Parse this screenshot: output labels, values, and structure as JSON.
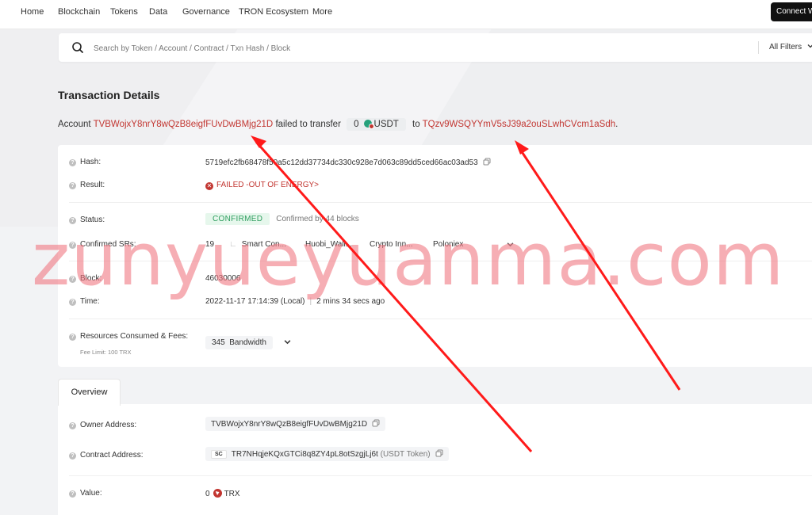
{
  "nav": {
    "items": [
      "Home",
      "Blockchain",
      "Tokens",
      "Data",
      "Governance",
      "TRON Ecosystem",
      "More"
    ],
    "connect_label": "Connect Wallet"
  },
  "search": {
    "placeholder": "Search by Token / Account / Contract / Txn Hash / Block",
    "filters_label": "All Filters"
  },
  "page": {
    "title": "Transaction Details",
    "summary": {
      "prefix": "Account",
      "from_address": "TVBWojxY8nrY8wQzB8eigfFUvDwBMjg21D",
      "middle": "failed to transfer",
      "amount": "0",
      "token": "USDT",
      "to_word": "to",
      "to_address": "TQzv9WSQYYmV5sJ39a2ouSLwhCVcm1aSdh",
      "suffix": "."
    }
  },
  "details": {
    "hash_label": "Hash:",
    "hash_value": "5719efc2fb68478f50a5c12dd37734dc330c928e7d063c89dd5ced66ac03ad53",
    "result_label": "Result:",
    "result_value": "FAILED -OUT OF ENERGY>",
    "status_label": "Status:",
    "status_badge": "CONFIRMED",
    "status_text": "Confirmed by 44 blocks",
    "confirmed_sr_label": "Confirmed SRs:",
    "confirmed_sr_items": [
      "19",
      "Smart Con...",
      "Huobi_Wall...",
      "Crypto Inn...",
      "Poloniex"
    ],
    "block_label": "Block:",
    "block_value": "46030006",
    "time_label": "Time:",
    "time_value": "2022-11-17 17:14:39 (Local)",
    "time_sep": "|",
    "time_ago": "2 mins 34 secs ago",
    "resources_label": "Resources Consumed & Fees:",
    "fee_limit": "Fee Limit: 100 TRX",
    "resource_amount": "345",
    "resource_unit": "Bandwidth"
  },
  "tabs": {
    "overview": "Overview"
  },
  "overview": {
    "owner_label": "Owner Address:",
    "owner_value": "TVBWojxY8nrY8wQzB8eigfFUvDwBMjg21D",
    "contract_label": "Contract Address:",
    "contract_tag": "SC",
    "contract_value": "TR7NHqjeKQxGTCi8q8ZY4pL8otSzgjLj6t",
    "contract_note": "(USDT Token)",
    "value_label": "Value:",
    "value_amount": "0",
    "value_unit": "TRX"
  },
  "watermark": "zunyueyuanma.com",
  "colors": {
    "accent_red": "#c23631",
    "confirmed_green": "#2f9e5f",
    "arrow_red": "#ff1a1a",
    "watermark_pink": "#f07882"
  }
}
